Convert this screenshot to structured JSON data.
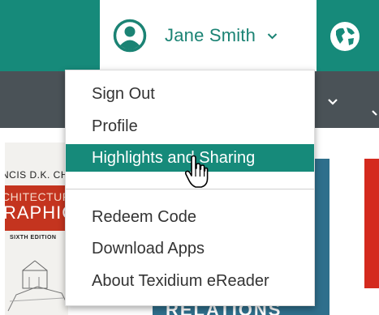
{
  "header": {
    "user_name": "Jane Smith"
  },
  "user_menu": {
    "items": [
      {
        "label": "Sign Out"
      },
      {
        "label": "Profile"
      },
      {
        "label": "Highlights and Sharing",
        "state": "hover"
      },
      {
        "label": "Redeem Code"
      },
      {
        "label": "Download Apps"
      },
      {
        "label": "About Texidium eReader"
      }
    ]
  },
  "books": [
    {
      "cover_top": "NCIS D.K. CH",
      "cover_line1": "CHITECTUR",
      "cover_line2": "RAPHIC",
      "cover_edition": "SIXTH EDITION"
    },
    {
      "cover_bottom": "RELATIONS"
    }
  ],
  "colors": {
    "brand_teal": "#168a7a",
    "subnav_gray": "#4a5257",
    "menu_hover": "#168a7a"
  }
}
